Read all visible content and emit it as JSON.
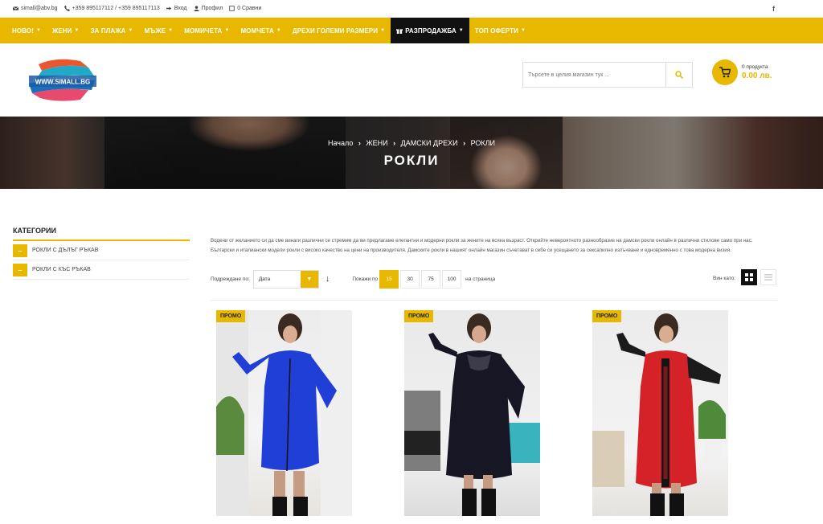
{
  "topbar": {
    "email": "simall@abv.bg",
    "phones": "+359 895117112 / +359 895117113",
    "login": "Вход",
    "profile": "Профил",
    "compare": "0 Сравни",
    "facebook": "f"
  },
  "nav": {
    "items": [
      {
        "label": "НОВО!"
      },
      {
        "label": "ЖЕНИ"
      },
      {
        "label": "ЗА ПЛАЖА"
      },
      {
        "label": "МЪЖЕ"
      },
      {
        "label": "МОМИЧЕТА"
      },
      {
        "label": "МОМЧЕТА"
      },
      {
        "label": "ДРЕХИ ГОЛЕМИ РАЗМЕРИ"
      },
      {
        "label": "РАЗПРОДАЖБА"
      },
      {
        "label": "ТОП ОФЕРТИ"
      }
    ],
    "accent": "#e8b800"
  },
  "header": {
    "logo_text": "WWW.SIMALL.BG",
    "search_placeholder": "Търсете в целия магазин тук ...",
    "cart_count": "0 продукта",
    "cart_total": "0.00 лв."
  },
  "banner": {
    "breadcrumb": [
      "Начало",
      "ЖЕНИ",
      "ДАМСКИ ДРЕХИ",
      "РОКЛИ"
    ],
    "title": "РОКЛИ"
  },
  "sidebar": {
    "heading": "КАТЕГОРИИ",
    "items": [
      {
        "label": "РОКЛИ С ДЪЛЪГ РЪКАВ"
      },
      {
        "label": "РОКЛИ С КЪС РЪКАВ"
      }
    ]
  },
  "content": {
    "description": "Водени от желанието си да сме винаги различни се стремим да ви предлагаме елегантни и модерни рокли за жените на всяка възраст. Открийте невероятното разнообразие на дамски рокли онлайн в различни стилове само при нас. Български и италиански модели рокли с високо качество на цени на производителя. Дамските рокли в нашият онлайн магазин съчетават в себе си усещането за сексапилно излъчване и едновременно с това модерна визия.",
    "sort_label": "Подреждане по:",
    "sort_value": "Дата",
    "show_label": "Покажи по",
    "per_page_options": [
      "15",
      "30",
      "75",
      "100"
    ],
    "per_page_active": "15",
    "per_page_suffix": "на страница",
    "view_label": "Вин като:"
  },
  "products": [
    {
      "badge": "ПРОМО",
      "dress_color": "#1f3fd6"
    },
    {
      "badge": "ПРОМО",
      "dress_color": "#161624"
    },
    {
      "badge": "ПРОМО",
      "dress_color": "#d52228"
    }
  ]
}
